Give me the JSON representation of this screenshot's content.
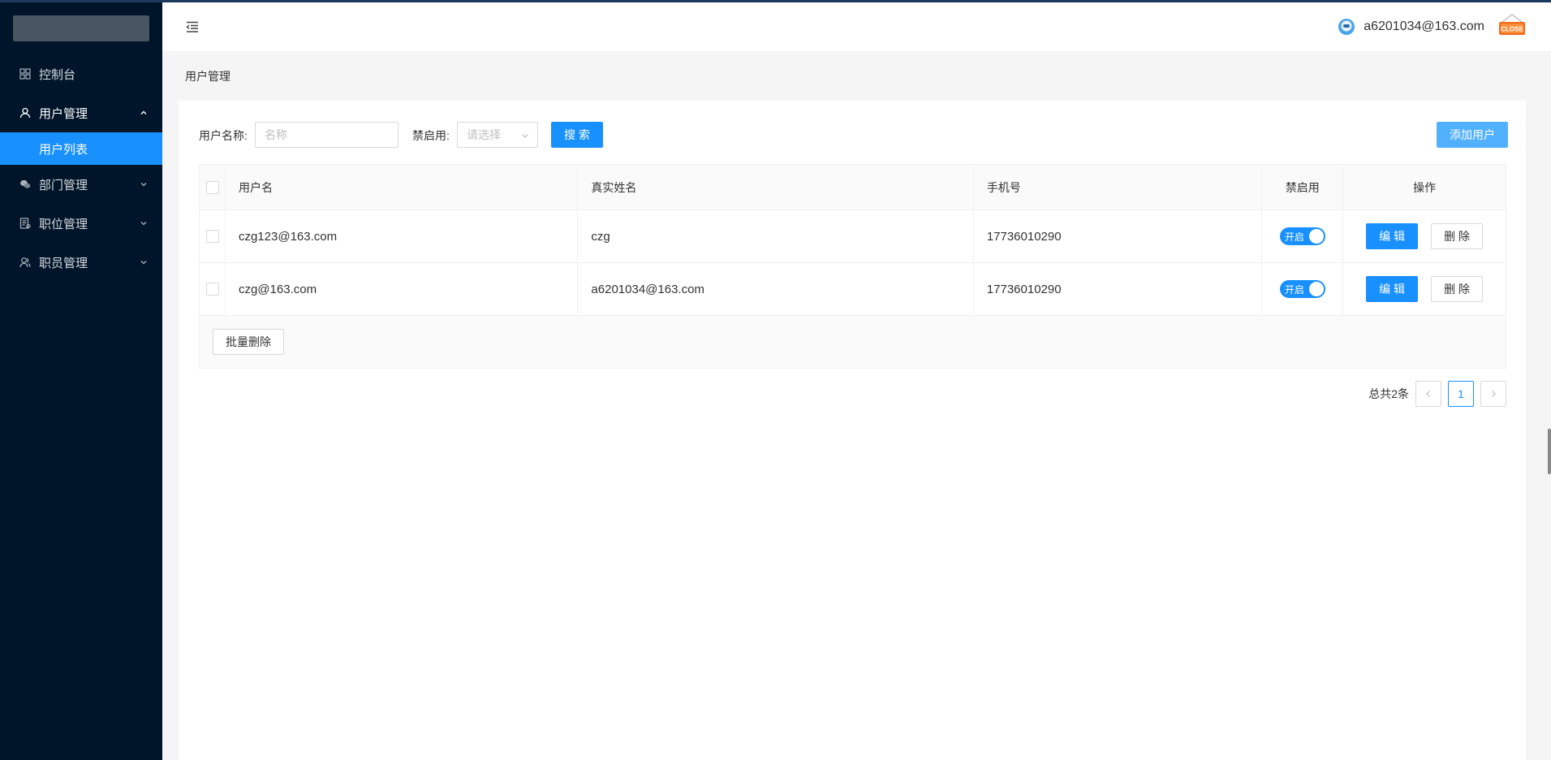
{
  "sidebar": {
    "items": [
      {
        "label": "控制台",
        "icon": "dashboard-icon"
      },
      {
        "label": "用户管理",
        "icon": "user-icon",
        "open": true,
        "children": [
          {
            "label": "用户列表",
            "active": true
          }
        ]
      },
      {
        "label": "部门管理",
        "icon": "wechat-icon"
      },
      {
        "label": "职位管理",
        "icon": "audit-icon"
      },
      {
        "label": "职员管理",
        "icon": "team-icon"
      }
    ]
  },
  "header": {
    "user_email": "a6201034@163.com",
    "close_icon_text": "CLOSE"
  },
  "breadcrumb": "用户管理",
  "filters": {
    "username_label": "用户名称:",
    "username_placeholder": "名称",
    "status_label": "禁启用:",
    "status_placeholder": "请选择",
    "search_label": "搜 索",
    "add_label": "添加用户"
  },
  "table": {
    "columns": [
      "用户名",
      "真实姓名",
      "手机号",
      "禁启用",
      "操作"
    ],
    "rows": [
      {
        "username": "czg123@163.com",
        "real_name": "czg",
        "phone": "17736010290",
        "switch_label": "开启",
        "edit": "编 辑",
        "delete": "删 除"
      },
      {
        "username": "czg@163.com",
        "real_name": "a6201034@163.com",
        "phone": "17736010290",
        "switch_label": "开启",
        "edit": "编 辑",
        "delete": "删 除"
      }
    ],
    "batch_delete": "批量删除"
  },
  "pagination": {
    "total": "总共2条",
    "current": "1"
  },
  "colors": {
    "sidebar_bg": "#001529",
    "primary": "#1890ff"
  }
}
